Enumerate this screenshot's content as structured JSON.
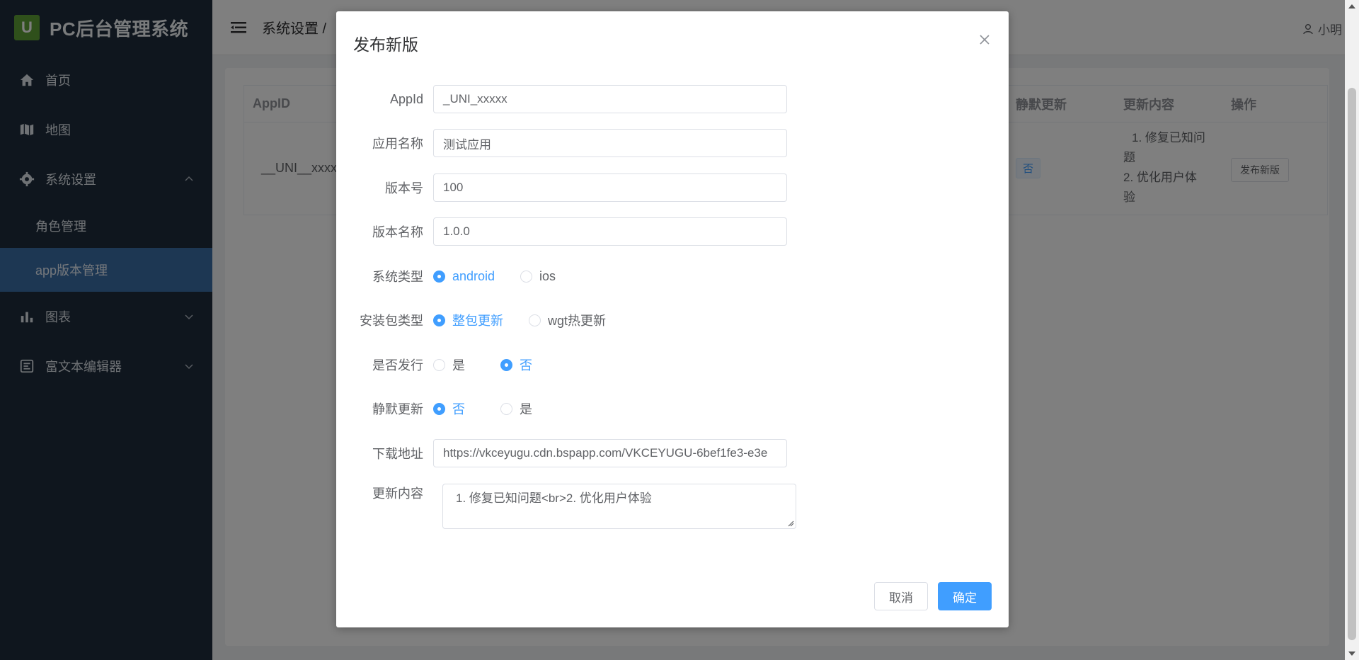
{
  "app": {
    "logo_letter": "U",
    "title": "PC后台管理系统"
  },
  "sidebar": {
    "items": [
      {
        "label": "首页",
        "icon": "home-icon"
      },
      {
        "label": "地图",
        "icon": "map-icon"
      },
      {
        "label": "系统设置",
        "icon": "gear-icon",
        "expanded": true,
        "children": [
          {
            "label": "角色管理"
          },
          {
            "label": "app版本管理",
            "active": true
          }
        ]
      },
      {
        "label": "图表",
        "icon": "bar-chart-icon"
      },
      {
        "label": "富文本编辑器",
        "icon": "editor-icon"
      }
    ]
  },
  "header": {
    "breadcrumb": "系统设置 /",
    "user": "小明"
  },
  "table": {
    "headers": {
      "appid": "AppID",
      "silent": "静默更新",
      "content": "更新内容",
      "action": "操作"
    },
    "row": {
      "appid": "__UNI__xxxxx",
      "silent": "否",
      "content_line1": "1. 修复已知问",
      "content_line2": "题",
      "content_line3": "2. 优化用户体",
      "content_line4": "验",
      "action": "发布新版"
    }
  },
  "dialog": {
    "title": "发布新版",
    "fields": {
      "appid": {
        "label": "AppId",
        "value": "_UNI_xxxxx"
      },
      "app_name": {
        "label": "应用名称",
        "value": "测试应用"
      },
      "version_code": {
        "label": "版本号",
        "value": "100"
      },
      "version_name": {
        "label": "版本名称",
        "value": "1.0.0"
      },
      "platform": {
        "label": "系统类型",
        "options": [
          "android",
          "ios"
        ],
        "selected": "android"
      },
      "package_type": {
        "label": "安装包类型",
        "options": [
          "整包更新",
          "wgt热更新"
        ],
        "selected": "整包更新"
      },
      "publish": {
        "label": "是否发行",
        "options": [
          "是",
          "否"
        ],
        "selected": "否"
      },
      "silent": {
        "label": "静默更新",
        "options": [
          "否",
          "是"
        ],
        "selected": "否"
      },
      "download_url": {
        "label": "下载地址",
        "value": "https://vkceyugu.cdn.bspapp.com/VKCEYUGU-6bef1fe3-e3e"
      },
      "contents": {
        "label": "更新内容",
        "value": "1. 修复已知问题<br>2. 优化用户体验"
      }
    },
    "cancel_label": "取消",
    "confirm_label": "确定"
  },
  "colors": {
    "primary": "#409eff",
    "sidebar_bg": "#1f2d3d",
    "sidebar_active": "#3b6fa7",
    "logo_green": "#5fa136"
  }
}
